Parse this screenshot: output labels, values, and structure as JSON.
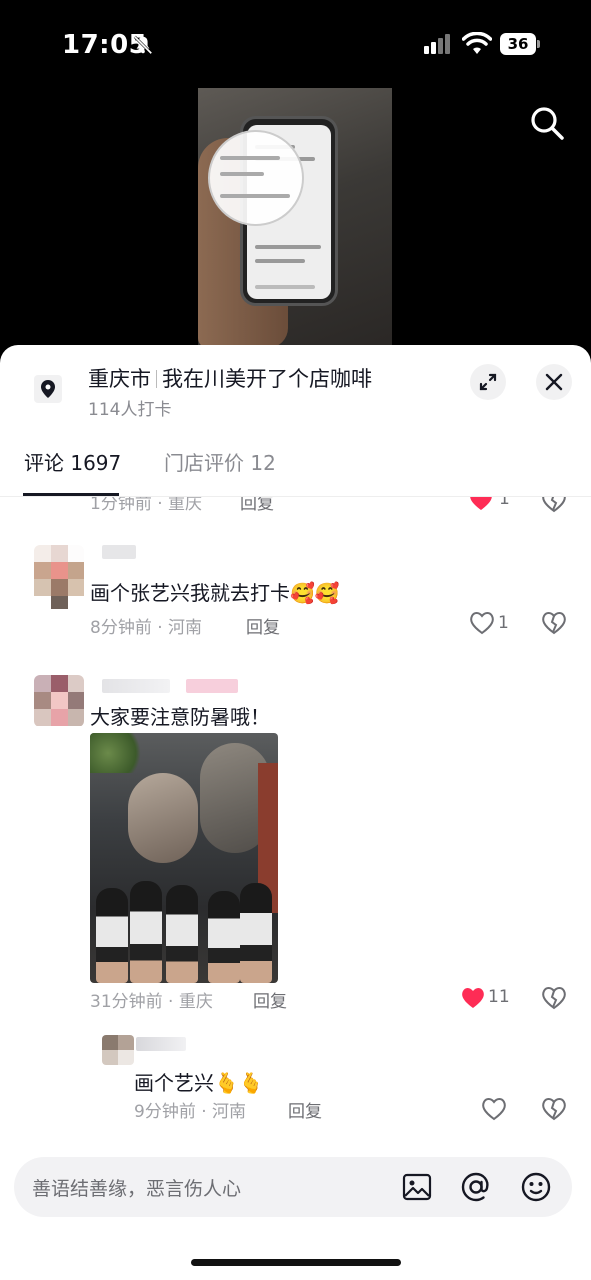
{
  "status_bar": {
    "time": "17:05",
    "battery": "36"
  },
  "location": {
    "city": "重庆市",
    "shop": "我在川美开了个店咖啡",
    "checkins": "114人打卡"
  },
  "tabs": [
    {
      "label": "评论 1697",
      "active": true
    },
    {
      "label": "门店评价 12",
      "active": false
    }
  ],
  "comments": [
    {
      "text": "",
      "meta": "1分钟前 · 重庆",
      "reply": "回复",
      "likes": "1",
      "liked": true
    },
    {
      "text": "画个张艺兴我就去打卡🥰🥰",
      "meta": "8分钟前 · 河南",
      "reply": "回复",
      "likes": "1",
      "liked": false
    },
    {
      "text": "大家要注意防暑哦！",
      "meta": "31分钟前 · 重庆",
      "reply": "回复",
      "likes": "11",
      "liked": true,
      "replies": [
        {
          "text": "画个艺兴🫰🫰",
          "meta": "9分钟前 · 河南",
          "reply": "回复",
          "likes": "",
          "liked": false
        }
      ]
    }
  ],
  "input": {
    "placeholder": "善语结善缘，恶言伤人心"
  },
  "colors": {
    "like_red": "#fe2c55",
    "text": "#161823",
    "muted": "#a0a1a6"
  }
}
